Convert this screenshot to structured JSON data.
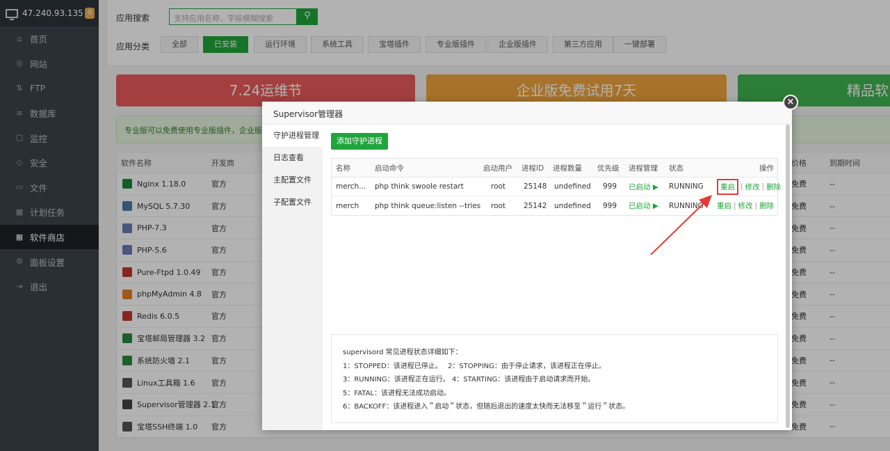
{
  "sidebar": {
    "ip": "47.240.93.135",
    "badge": "0",
    "items": [
      {
        "label": "首页",
        "icon": "home-icon",
        "glyph": "⌂"
      },
      {
        "label": "网站",
        "icon": "globe-icon",
        "glyph": "◎"
      },
      {
        "label": "FTP",
        "icon": "ftp-icon",
        "glyph": "⇅"
      },
      {
        "label": "数据库",
        "icon": "database-icon",
        "glyph": "≡"
      },
      {
        "label": "监控",
        "icon": "monitor-icon",
        "glyph": "▢"
      },
      {
        "label": "安全",
        "icon": "shield-icon",
        "glyph": "◇"
      },
      {
        "label": "文件",
        "icon": "folder-icon",
        "glyph": "▭"
      },
      {
        "label": "计划任务",
        "icon": "calendar-icon",
        "glyph": "▦"
      },
      {
        "label": "软件商店",
        "icon": "grid-icon",
        "glyph": "▦"
      },
      {
        "label": "面板设置",
        "icon": "gear-icon",
        "glyph": "⚙"
      },
      {
        "label": "退出",
        "icon": "logout-icon",
        "glyph": "⇥"
      }
    ]
  },
  "store": {
    "search_label": "应用搜索",
    "search_placeholder": "支持应用名称、字段模糊搜索",
    "category_label": "应用分类",
    "categories": [
      "全部",
      "已安装",
      "运行环境",
      "系统工具",
      "宝塔插件",
      "专业版插件",
      "企业版插件",
      "第三方应用",
      "一键部署"
    ],
    "banners": [
      "7.24运维节",
      "企业版免费试用7天",
      "精品软件"
    ],
    "notice": "专业版可以免费使用专业版插件，企业版可以",
    "table_headers": [
      "软件名称",
      "开发商",
      "价格",
      "到期时间"
    ],
    "softwares": [
      {
        "name": "Nginx 1.18.0",
        "dev": "官方",
        "price": "免费",
        "expire": "--"
      },
      {
        "name": "MySQL 5.7.30",
        "dev": "官方",
        "price": "免费",
        "expire": "--"
      },
      {
        "name": "PHP-7.3",
        "dev": "官方",
        "price": "免费",
        "expire": "--"
      },
      {
        "name": "PHP-5.6",
        "dev": "官方",
        "price": "免费",
        "expire": "--"
      },
      {
        "name": "Pure-Ftpd 1.0.49",
        "dev": "官方",
        "price": "免费",
        "expire": "--"
      },
      {
        "name": "phpMyAdmin 4.8",
        "dev": "官方",
        "price": "免费",
        "expire": "--"
      },
      {
        "name": "Redis 6.0.5",
        "dev": "官方",
        "price": "免费",
        "expire": "--"
      },
      {
        "name": "宝塔邮局管理器 3.2",
        "dev": "官方",
        "price": "免费",
        "expire": "--"
      },
      {
        "name": "系统防火墙 2.1",
        "dev": "官方",
        "price": "免费",
        "expire": "--"
      },
      {
        "name": "Linux工具箱 1.6",
        "dev": "官方",
        "price": "免费",
        "expire": "--"
      },
      {
        "name": "Supervisor管理器 2.1",
        "dev": "官方",
        "price": "免费",
        "expire": "--"
      },
      {
        "name": "宝塔SSH终端 1.0",
        "dev": "官方",
        "price": "免费",
        "expire": "--"
      }
    ]
  },
  "modal": {
    "title": "Supervisor管理器",
    "tabs": [
      "守护进程管理",
      "日志查看",
      "主配置文件",
      "子配置文件"
    ],
    "add_button": "添加守护进程",
    "headers": [
      "名称",
      "启动命令",
      "启动用户",
      "进程ID",
      "进程数量",
      "优先级",
      "进程管理",
      "状态",
      "操作"
    ],
    "processes": [
      {
        "name": "merch...",
        "cmd": "php think swoole restart",
        "user": "root",
        "pid": "25148",
        "count": "undefined",
        "priority": "999",
        "mgmt": "已启动 ▶",
        "status": "RUNNING",
        "op_restart": "重启",
        "op_edit": "修改",
        "op_delete": "删除"
      },
      {
        "name": "merch",
        "cmd": "php think queue:listen --tries",
        "user": "root",
        "pid": "25142",
        "count": "undefined",
        "priority": "999",
        "mgmt": "已启动 ▶",
        "status": "RUNNING",
        "op_restart": "重启",
        "op_edit": "修改",
        "op_delete": "删除"
      }
    ],
    "op_sep": "|",
    "info_lines": [
      "supervisord 常见进程状态详细如下：",
      "1：STOPPED：该进程已停止。　 2：STOPPING：由于停止请求，该进程正在停止。",
      "3：RUNNING：该进程正在运行。 4：STARTING：该进程由于启动请求而开始。",
      "5：FATAL：该进程无法成功启动。",
      "6：BACKOFF：该进程进入＂启动＂状态，但随后退出的速度太快而无法移至＂运行＂状态。"
    ]
  },
  "colors": {
    "accent": "#20a53a",
    "sidebar": "#3c444d",
    "highlight": "#e53935"
  }
}
